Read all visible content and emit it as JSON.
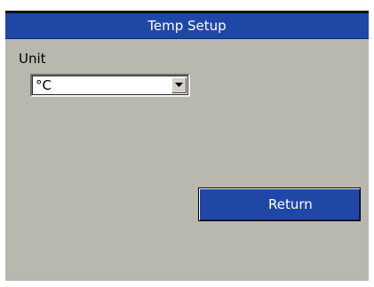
{
  "window": {
    "title": "Temp Setup"
  },
  "unit": {
    "label": "Unit",
    "selected_value": "°C"
  },
  "buttons": {
    "return_label": "Return"
  },
  "icons": {
    "dropdown": "chevron-down-icon"
  },
  "colors": {
    "title_bar": "#1f48a6",
    "button": "#1f48a6",
    "panel": "#b9b8ae"
  }
}
